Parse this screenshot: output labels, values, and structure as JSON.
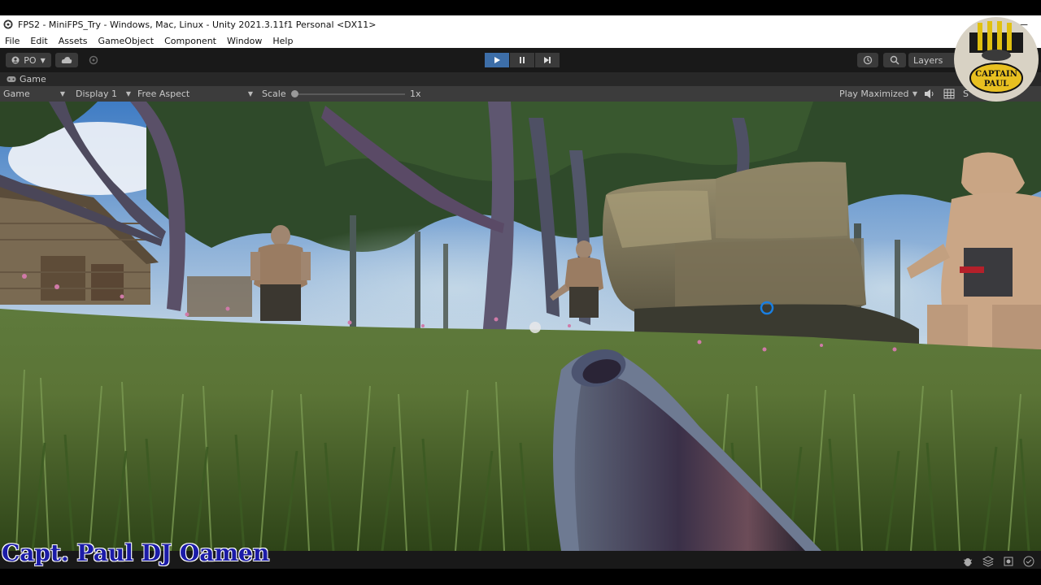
{
  "window": {
    "title": "FPS2 - MiniFPS_Try - Windows, Mac, Linux - Unity 2021.3.11f1 Personal <DX11>",
    "minimize_glyph": "—"
  },
  "menu": [
    "File",
    "Edit",
    "Assets",
    "GameObject",
    "Component",
    "Window",
    "Help"
  ],
  "toolbar": {
    "account_label": "PO",
    "layers_label": "Layers",
    "play_icon": "play-icon",
    "pause_icon": "pause-icon",
    "step_icon": "step-icon"
  },
  "game_tab": {
    "label": "Game"
  },
  "game_bar": {
    "view_select": "Game",
    "display_select": "Display 1",
    "aspect_select": "Free Aspect",
    "scale_label": "Scale",
    "scale_value": "1x",
    "play_mode_select": "Play Maximized",
    "stats_label": "S"
  },
  "logo": {
    "text_line1": "CAPTAIN",
    "text_line2": "PAUL"
  },
  "watermark": {
    "text": "Capt. Paul DJ Oamen"
  },
  "colors": {
    "unity_dark": "#191919",
    "play_active": "#3d6ea8",
    "watermark_blue": "#1b1ba8",
    "crosshair": "#1a7fe0"
  }
}
